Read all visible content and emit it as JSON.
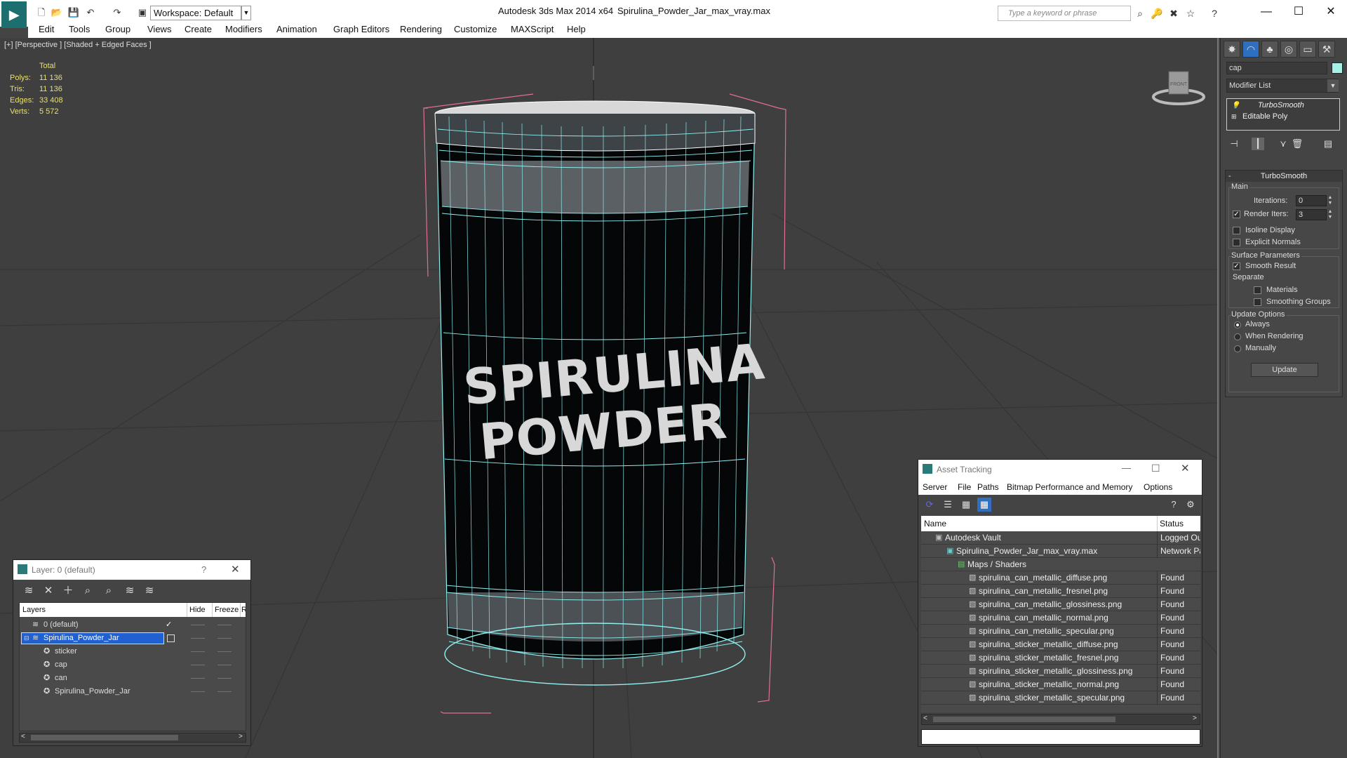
{
  "titlebar": {
    "workspace": "Workspace: Default",
    "app_title": "Autodesk 3ds Max  2014 x64",
    "file_title": "Spirulina_Powder_Jar_max_vray.max",
    "search_placeholder": "Type a keyword or phrase",
    "minimize": "—",
    "maximize": "☐",
    "close": "✕"
  },
  "menu": [
    "Edit",
    "Tools",
    "Group",
    "Views",
    "Create",
    "Modifiers",
    "Animation",
    "Graph Editors",
    "Rendering",
    "Customize",
    "MAXScript",
    "Help"
  ],
  "viewport": {
    "label": "[+] [Perspective ] [Shaded + Edged Faces ]",
    "stats_header": "Total",
    "stats": [
      {
        "label": "Polys:",
        "value": "11 136"
      },
      {
        "label": "Tris:",
        "value": "11 136"
      },
      {
        "label": "Edges:",
        "value": "33 408"
      },
      {
        "label": "Verts:",
        "value": "5 572"
      }
    ],
    "jar_text_line1": "SPIRULINA",
    "jar_text_line2": "POWDER",
    "viewcube_label": "FRONT"
  },
  "cmdpanel": {
    "object_name": "cap",
    "object_color": "#a6f0e6",
    "modifier_list": "Modifier List",
    "stack": [
      "TurboSmooth",
      "Editable Poly"
    ],
    "rollout_title": "TurboSmooth",
    "main_group": "Main",
    "iterations_label": "Iterations:",
    "iterations_value": "0",
    "render_iters_label": "Render Iters:",
    "render_iters_value": "3",
    "isoline_label": "Isoline Display",
    "explicit_normals_label": "Explicit Normals",
    "surface_group": "Surface Parameters",
    "smooth_result_label": "Smooth Result",
    "separate_label": "Separate",
    "materials_label": "Materials",
    "smoothing_groups_label": "Smoothing Groups",
    "update_group": "Update Options",
    "always_label": "Always",
    "when_rendering_label": "When Rendering",
    "manually_label": "Manually",
    "update_button": "Update"
  },
  "layer_dialog": {
    "title": "Layer: 0 (default)",
    "help": "?",
    "close": "✕",
    "col_layers": "Layers",
    "col_hide": "Hide",
    "col_freeze": "Freeze",
    "col_render": "Re",
    "rows": [
      {
        "name": "0 (default)",
        "level": 0,
        "selected": false
      },
      {
        "name": "Spirulina_Powder_Jar",
        "level": 0,
        "selected": true
      },
      {
        "name": "sticker",
        "level": 1,
        "selected": false
      },
      {
        "name": "cap",
        "level": 1,
        "selected": false
      },
      {
        "name": "can",
        "level": 1,
        "selected": false
      },
      {
        "name": "Spirulina_Powder_Jar",
        "level": 1,
        "selected": false
      }
    ]
  },
  "asset_dialog": {
    "title": "Asset Tracking",
    "menu": [
      "Server",
      "File",
      "Paths",
      "Bitmap Performance and Memory",
      "Options"
    ],
    "col_name": "Name",
    "col_status": "Status",
    "rows": [
      {
        "name": "Autodesk Vault",
        "level": 0,
        "status": "Logged Out"
      },
      {
        "name": "Spirulina_Powder_Jar_max_vray.max",
        "level": 1,
        "status": "Network Pa"
      },
      {
        "name": "Maps / Shaders",
        "level": 2,
        "status": ""
      },
      {
        "name": "spirulina_can_metallic_diffuse.png",
        "level": 3,
        "status": "Found"
      },
      {
        "name": "spirulina_can_metallic_fresnel.png",
        "level": 3,
        "status": "Found"
      },
      {
        "name": "spirulina_can_metallic_glossiness.png",
        "level": 3,
        "status": "Found"
      },
      {
        "name": "spirulina_can_metallic_normal.png",
        "level": 3,
        "status": "Found"
      },
      {
        "name": "spirulina_can_metallic_specular.png",
        "level": 3,
        "status": "Found"
      },
      {
        "name": "spirulina_sticker_metallic_diffuse.png",
        "level": 3,
        "status": "Found"
      },
      {
        "name": "spirulina_sticker_metallic_fresnel.png",
        "level": 3,
        "status": "Found"
      },
      {
        "name": "spirulina_sticker_metallic_glossiness.png",
        "level": 3,
        "status": "Found"
      },
      {
        "name": "spirulina_sticker_metallic_normal.png",
        "level": 3,
        "status": "Found"
      },
      {
        "name": "spirulina_sticker_metallic_specular.png",
        "level": 3,
        "status": "Found"
      }
    ]
  },
  "colors": {
    "selection_blue": "#2060d0",
    "wire_cyan": "#8ff0f0",
    "bbox_pink": "#e07090",
    "stat_yellow": "#e8e070"
  }
}
